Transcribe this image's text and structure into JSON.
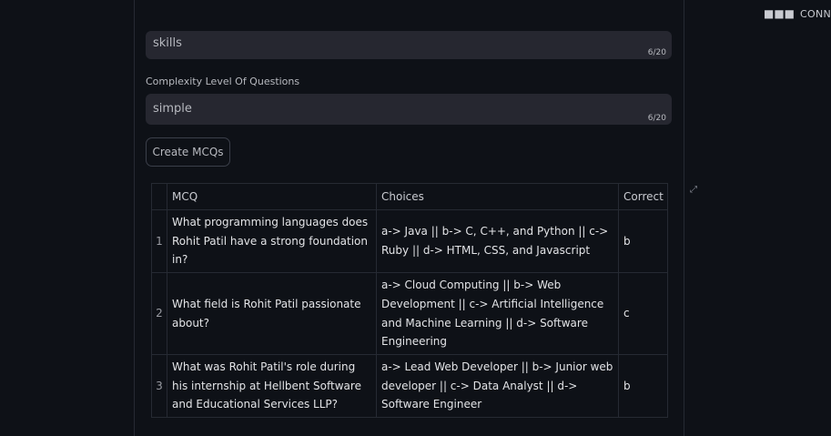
{
  "topbar": {
    "menu_icon": "more-dots-icon",
    "status": "CONN"
  },
  "inputs": [
    {
      "value": "skills",
      "counter": "6/20"
    },
    {
      "label": "Complexity Level Of Questions",
      "value": "simple",
      "counter": "6/20"
    }
  ],
  "create_button": "Create MCQs",
  "table": {
    "headers": [
      "",
      "MCQ",
      "Choices",
      "Correct"
    ],
    "rows": [
      {
        "index": "1",
        "mcq": "What programming languages does Rohit Patil have a strong foundation in?",
        "choices": "a-> Java || b-> C, C++, and Python || c-> Ruby || d-> HTML, CSS, and Javascript",
        "correct": "b"
      },
      {
        "index": "2",
        "mcq": "What field is Rohit Patil passionate about?",
        "choices": "a-> Cloud Computing || b-> Web Development || c-> Artificial Intelligence and Machine Learning || d-> Software Engineering",
        "correct": "c"
      },
      {
        "index": "3",
        "mcq": "What was Rohit Patil's role during his internship at Hellbent Software and Educational Services LLP?",
        "choices": "a-> Lead Web Developer || b-> Junior web developer || c-> Data Analyst || d-> Software Engineer",
        "correct": "b"
      }
    ]
  }
}
